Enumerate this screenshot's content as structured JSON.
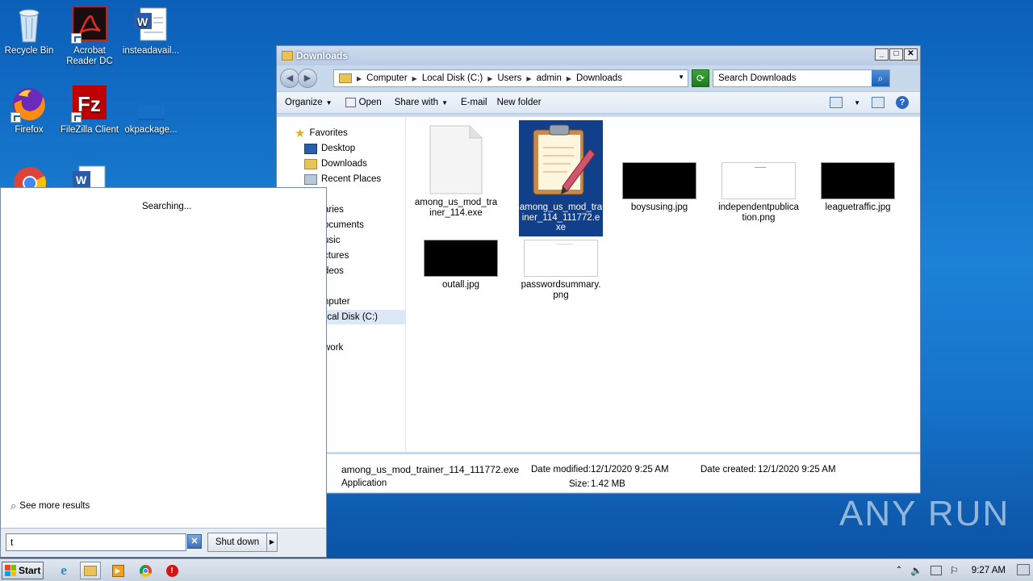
{
  "desktop": {
    "icons": [
      {
        "label": "Recycle Bin"
      },
      {
        "label": "Acrobat Reader DC"
      },
      {
        "label": "insteadavail..."
      },
      {
        "label": "Firefox"
      },
      {
        "label": "FileZilla Client"
      },
      {
        "label": "okpackage..."
      }
    ]
  },
  "explorer": {
    "title": "Downloads",
    "breadcrumb": [
      "Computer",
      "Local Disk (C:)",
      "Users",
      "admin",
      "Downloads"
    ],
    "search_placeholder": "Search Downloads",
    "toolbar": {
      "organize": "Organize",
      "open": "Open",
      "share_with": "Share with",
      "email": "E-mail",
      "new_folder": "New folder"
    },
    "nav": {
      "favorites": "Favorites",
      "desktop": "Desktop",
      "downloads": "Downloads",
      "recent_places": "Recent Places",
      "libraries": "aries",
      "documents": "ocuments",
      "music": "usic",
      "pictures": "ctures",
      "videos": "deos",
      "computer": "nputer",
      "local_disk": "ocal Disk (C:)",
      "network": "work"
    },
    "files": [
      {
        "name": "among_us_mod_trainer_114.exe",
        "line1": "among_us_mod_tra",
        "line2": "iner_114.exe",
        "line3": ""
      },
      {
        "name": "among_us_mod_trainer_114_111772.exe",
        "line1": "among_us_mod_tra",
        "line2": "iner_114_111772.e",
        "line3": "xe"
      },
      {
        "name": "boysusing.jpg",
        "line1": "boysusing.jpg",
        "line2": "",
        "line3": ""
      },
      {
        "name": "independentpublication.png",
        "line1": "independentpublica",
        "line2": "tion.png",
        "line3": ""
      },
      {
        "name": "leaguetraffic.jpg",
        "line1": "leaguetraffic.jpg",
        "line2": "",
        "line3": ""
      },
      {
        "name": "outall.jpg",
        "line1": "outall.jpg",
        "line2": "",
        "line3": ""
      },
      {
        "name": "passwordsummary.png",
        "line1": "passwordsummary.",
        "line2": "png",
        "line3": ""
      }
    ],
    "details": {
      "filename": "among_us_mod_trainer_114_111772.exe",
      "type": "Application",
      "date_modified_label": "Date modified:",
      "date_modified": "12/1/2020 9:25 AM",
      "date_created_label": "Date created:",
      "date_created": "12/1/2020 9:25 AM",
      "size_label": "Size:",
      "size": "1.42 MB"
    }
  },
  "start_menu": {
    "searching": "Searching...",
    "see_more": "See more results",
    "search_value": "t",
    "shutdown": "Shut down"
  },
  "taskbar": {
    "start": "Start",
    "clock": "9:27 AM"
  },
  "watermark": "ANY RUN"
}
